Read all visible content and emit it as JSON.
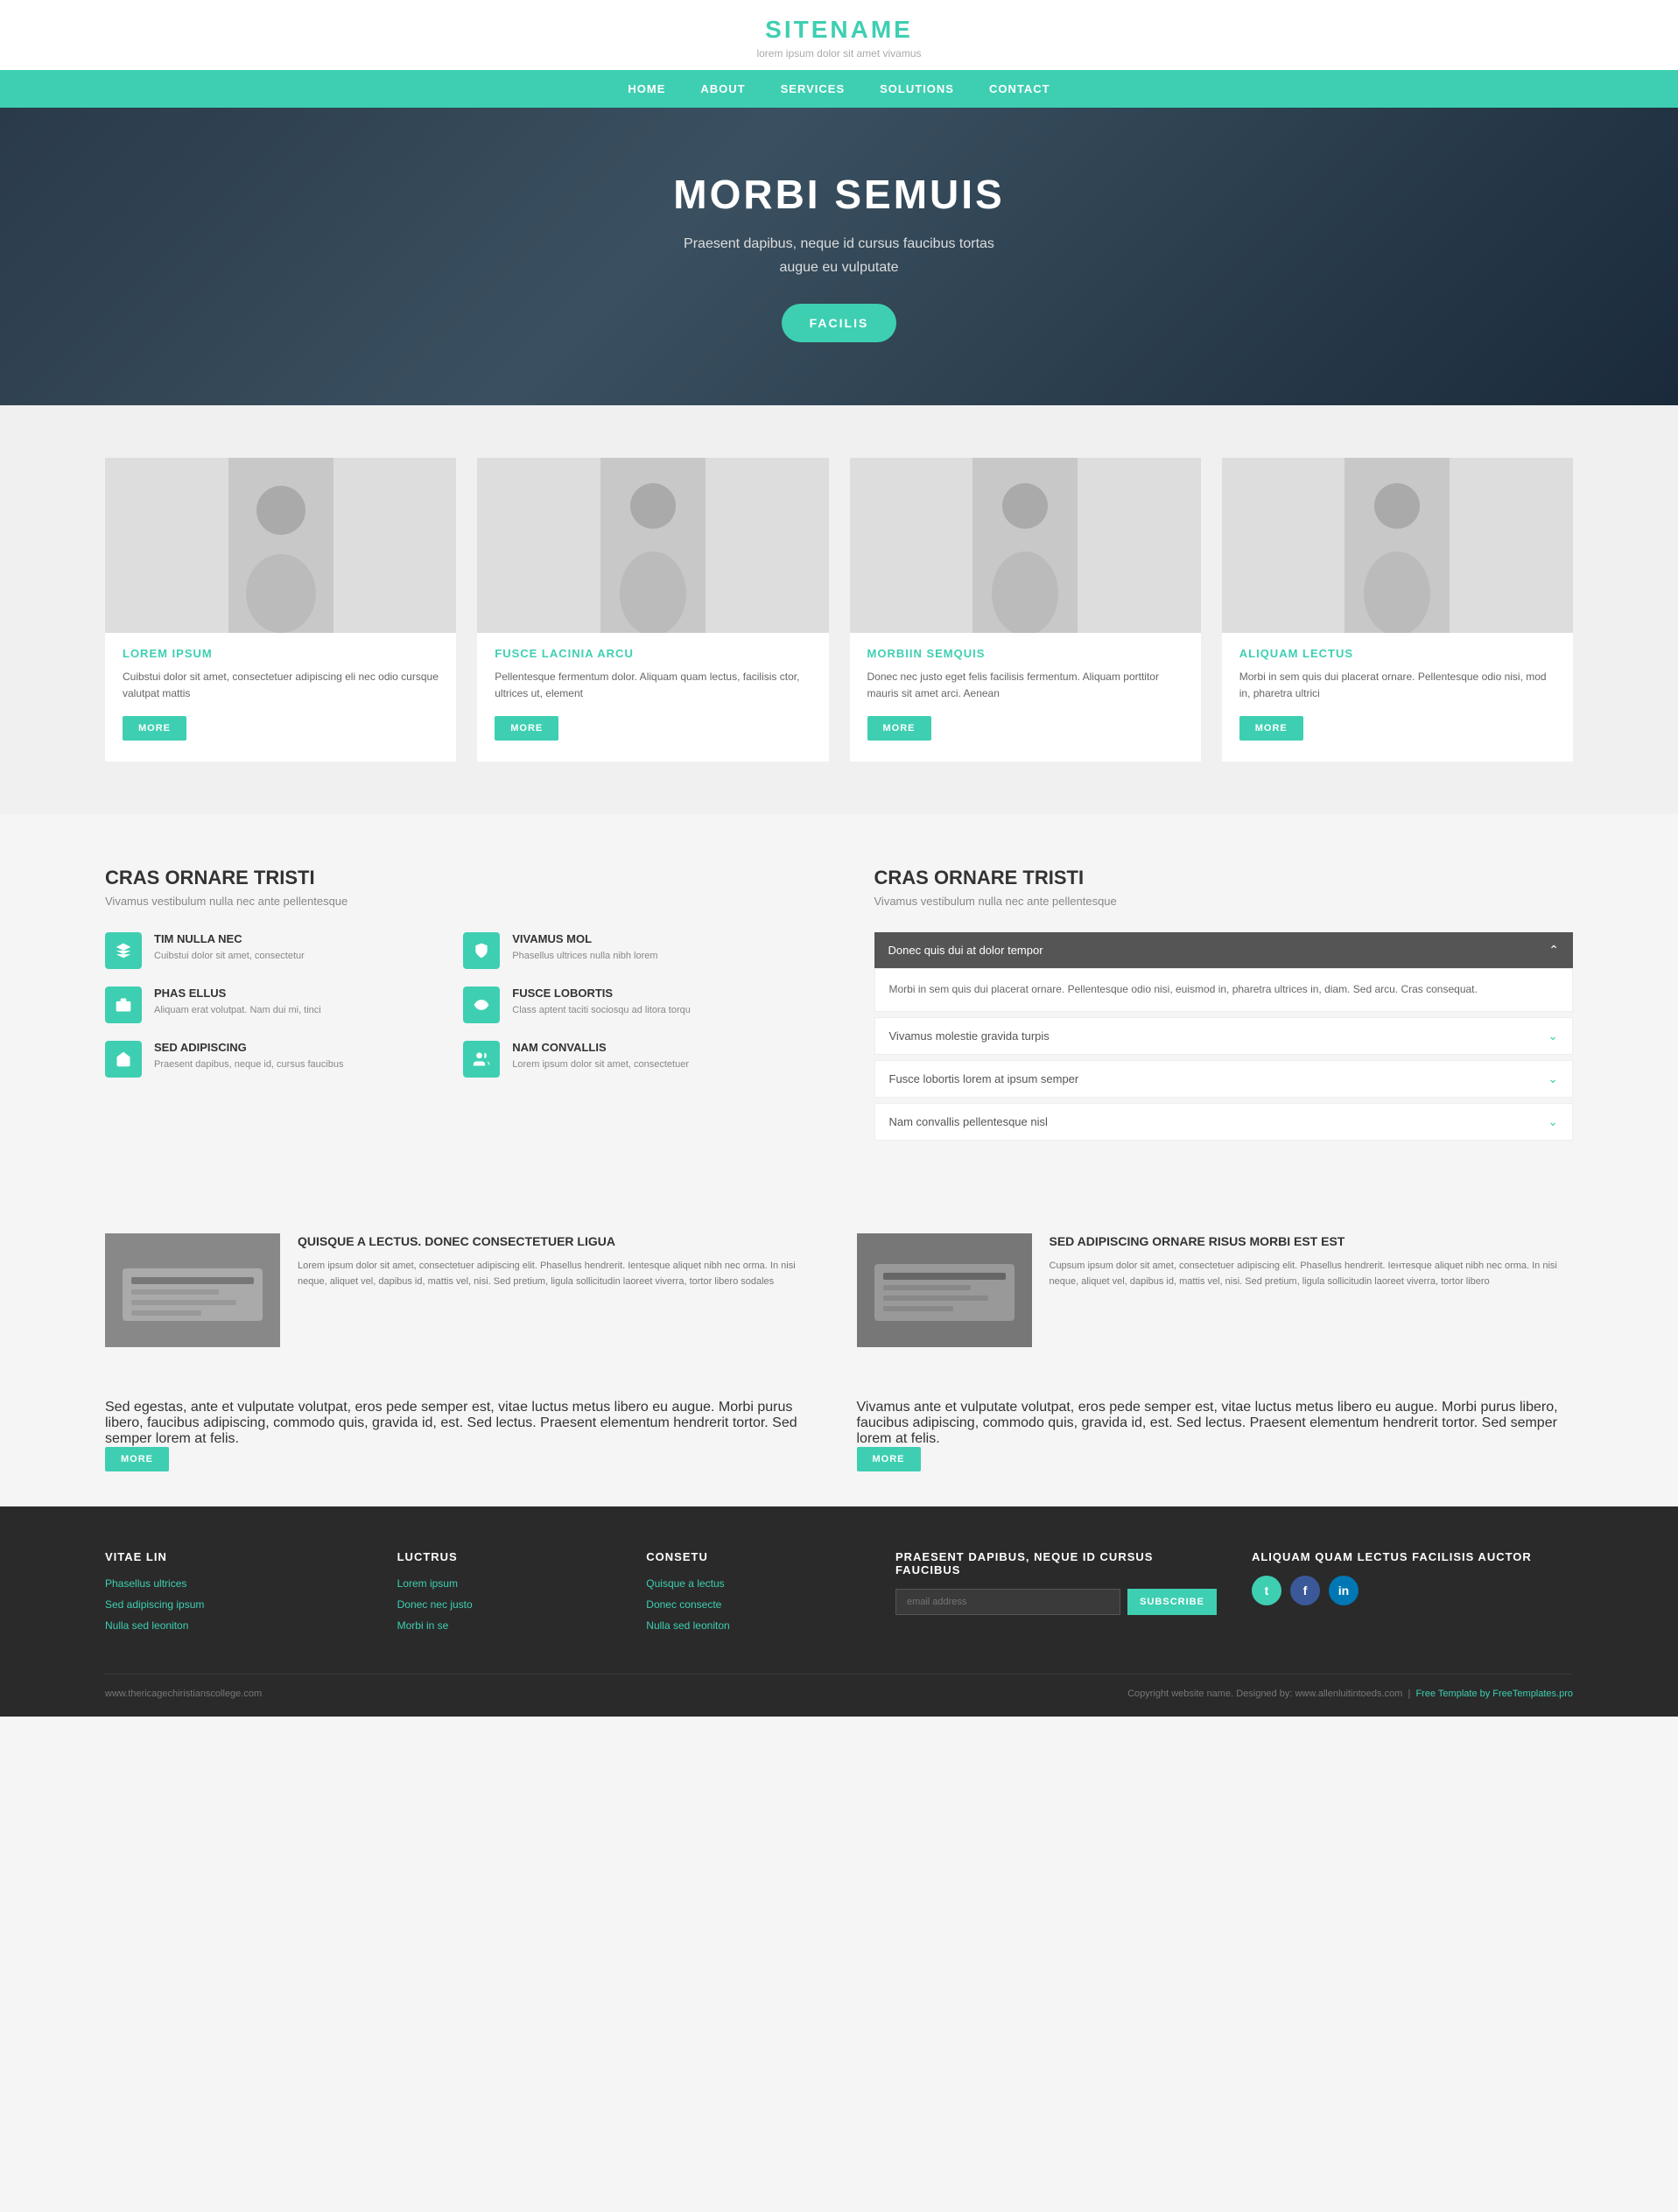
{
  "header": {
    "title": "SITENAME",
    "tagline": "lorem ipsum dolor sit amet vivamus"
  },
  "nav": {
    "items": [
      "HOME",
      "ABOUT",
      "SERVICES",
      "SOLUTIONS",
      "CONTACT"
    ]
  },
  "hero": {
    "heading": "MORBI SEMUIS",
    "subtext": "Praesent dapibus, neque id cursus faucibus tortas\naugue eu vulputate",
    "button_label": "FACILIS"
  },
  "cards": [
    {
      "title": "LOREM IPSUM",
      "text": "Cuibstui dolor sit amet, consectetuer adipiscing eli nec odio cursque valutpat mattis",
      "btn": "MORE",
      "icon": "👩"
    },
    {
      "title": "FUSCE LACINIA ARCU",
      "text": "Pellentesque fermentum dolor. Aliquam quam lectus, facilisis ctor, ultrices ut, element",
      "btn": "MORE",
      "icon": "👨"
    },
    {
      "title": "MORBIIN SEMQUIS",
      "text": "Donec nec justo eget felis facilisis fermentum. Aliquam porttitor mauris sit amet arci. Aenean",
      "btn": "MORE",
      "icon": "👩"
    },
    {
      "title": "ALIQUAM LECTUS",
      "text": "Morbi in sem quis dui placerat ornare. Pellentesque odio nisi, mod in, pharetra ultrici",
      "btn": "MORE",
      "icon": "👨"
    }
  ],
  "features_left": {
    "heading": "CRAS ORNARE TRISTI",
    "sub": "Vivamus vestibulum nulla nec ante pellentesque",
    "items": [
      {
        "title": "TIM NULLA NEC",
        "text": "Cuibstui dolor sit amet, consectetur"
      },
      {
        "title": "VIVAMUS MOL",
        "text": "Phasellus ultrices nulla nibh lorem"
      },
      {
        "title": "PHAS ELLUS",
        "text": "Aliquam erat volutpat. Nam dui mi, tinci"
      },
      {
        "title": "FUSCE LOBORTIS",
        "text": "Class aptent taciti sociosqu ad litora torqu"
      },
      {
        "title": "SED ADIPISCING",
        "text": "Praesent dapibus, neque id, cursus faucibus"
      },
      {
        "title": "NAM CONVALLIS",
        "text": "Lorem ipsum dolor sit amet, consectetuer"
      }
    ]
  },
  "features_right": {
    "heading": "CRAS ORNARE TRISTI",
    "sub": "Vivamus vestibulum nulla nec ante pellentesque",
    "accordion": [
      {
        "label": "Donec quis dui at dolor tempor",
        "open": true,
        "content": "Morbi in sem quis dui placerat ornare. Pellentesque odio nisi, euismod in, pharetra ultrices in, diam. Sed arcu. Cras consequat."
      },
      {
        "label": "Vivamus molestie gravida turpis",
        "open": false,
        "content": ""
      },
      {
        "label": "Fusce lobortis lorem at ipsum semper",
        "open": false,
        "content": ""
      },
      {
        "label": "Nam convallis pellentesque nisl",
        "open": false,
        "content": ""
      }
    ]
  },
  "content_blocks": [
    {
      "heading": "QUISQUE A LECTUS. DONEC CONSECTETUER LIGUA",
      "text": "Lorem ipsum dolor sit amet, consectetuer adipiscing elit. Phasellus hendrerit. Ientesque aliquet nibh nec orma. In nisi neque, aliquet vel, dapibus id, mattis vel, nisi. Sed pretium, ligula sollicitudin laoreet viverra, tortor libero sodales",
      "icon": "⌨"
    },
    {
      "heading": "SED ADIPISCING ORNARE RISUS MORBI EST EST",
      "text": "Cupsum ipsum dolor sit amet, consectetuer adipiscing elit. Phasellus hendrerit. Iентesque aliquet nibh nec orma. In nisi neque, aliquet vel, dapibus id, mattis vel, nisi. Sed pretium, ligula sollicitudin laoreet viverra, tortor libero",
      "icon": "⌨"
    }
  ],
  "bottom_texts": [
    {
      "text": "Sed egestas, ante et vulputate volutpat, eros pede semper est, vitae luctus metus libero eu augue. Morbi purus libero, faucibus adipiscing, commodo quis, gravida id, est. Sed lectus. Praesent elementum hendrerit tortor. Sed semper lorem at felis.",
      "btn": "MORE"
    },
    {
      "text": "Vivamus ante et vulputate volutpat, eros pede semper est, vitae luctus metus libero eu augue. Morbi purus libero, faucibus adipiscing, commodo quis, gravida id, est. Sed lectus. Praesent elementum hendrerit tortor. Sed semper lorem at felis.",
      "btn": "MORE"
    }
  ],
  "footer": {
    "cols": [
      {
        "heading": "VITAE LIN",
        "links": [
          "Phasellus ultrices",
          "Sed adipiscing ipsum",
          "Nulla sed leoniton"
        ]
      },
      {
        "heading": "LUCTRUS",
        "links": [
          "Lorem ipsum",
          "Donec nec justo",
          "Morbi in se"
        ]
      },
      {
        "heading": "CONSETU",
        "links": [
          "Quisque a lectus",
          "Donec consecte",
          "Nulla sed leoniton"
        ]
      },
      {
        "heading": "PRAESENT DAPIBUS, NEQUE ID CURSUS FAUCIBUS",
        "placeholder": "email address",
        "subscribe_btn": "SUBSCRIBE"
      },
      {
        "heading": "ALIQUAM QUAM LECTUS FACILISIS AUCTOR",
        "socials": [
          "t",
          "f",
          "in"
        ]
      }
    ],
    "copyright": "Copyright website name. Designed by: www.allenluitintoeds.com",
    "free_template": "Free Template by FreeTemplates.pro",
    "site_url": "www.thericagechiristianscollege.com"
  }
}
